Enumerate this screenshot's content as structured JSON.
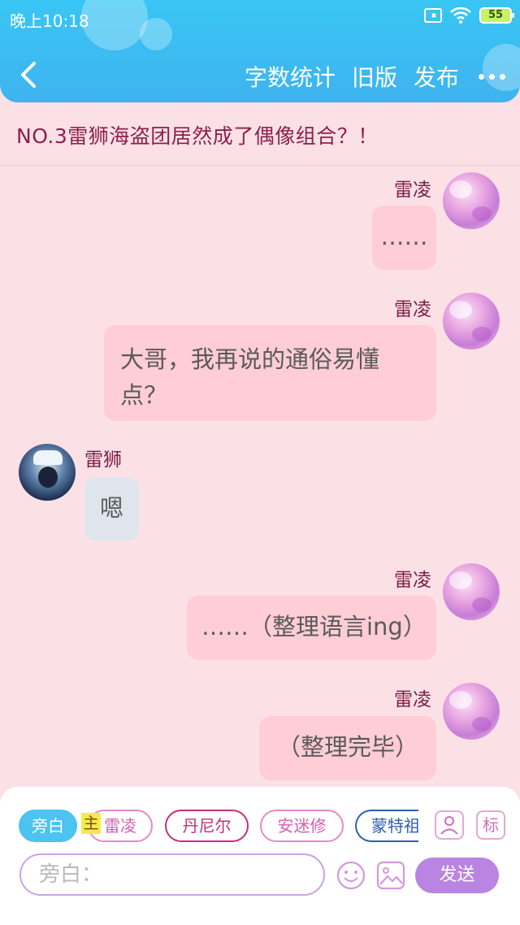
{
  "status": {
    "time": "晚上10:18",
    "battery": "55"
  },
  "toolbar": {
    "word_count": "字数统计",
    "old_version": "旧版",
    "publish": "发布"
  },
  "chapter": {
    "title": "NO.3雷狮海盗团居然成了偶像组合？！"
  },
  "messages": [
    {
      "speaker": "雷凌",
      "side": "right",
      "text": "……"
    },
    {
      "speaker": "雷凌",
      "side": "right",
      "line1": "大哥，我再说的通俗易懂",
      "line2": "点？"
    },
    {
      "speaker": "雷狮",
      "side": "left",
      "text": "嗯"
    },
    {
      "speaker": "雷凌",
      "side": "right",
      "text": "……（整理语言ing）"
    },
    {
      "speaker": "雷凌",
      "side": "right",
      "text": "（整理完毕）"
    }
  ],
  "roles": {
    "narration": "旁白",
    "main_tag": "主",
    "items": [
      "雷凌",
      "丹尼尔",
      "安迷修",
      "蒙特祖"
    ],
    "tag_button": "标"
  },
  "composer": {
    "placeholder": "旁白：",
    "send": "发送"
  },
  "colors": {
    "header": "#3fb3ee",
    "background": "#fbe1e6",
    "bubble_pink": "#ffcdd6",
    "bubble_grey": "#dfe5ec",
    "send": "#b984e2"
  }
}
